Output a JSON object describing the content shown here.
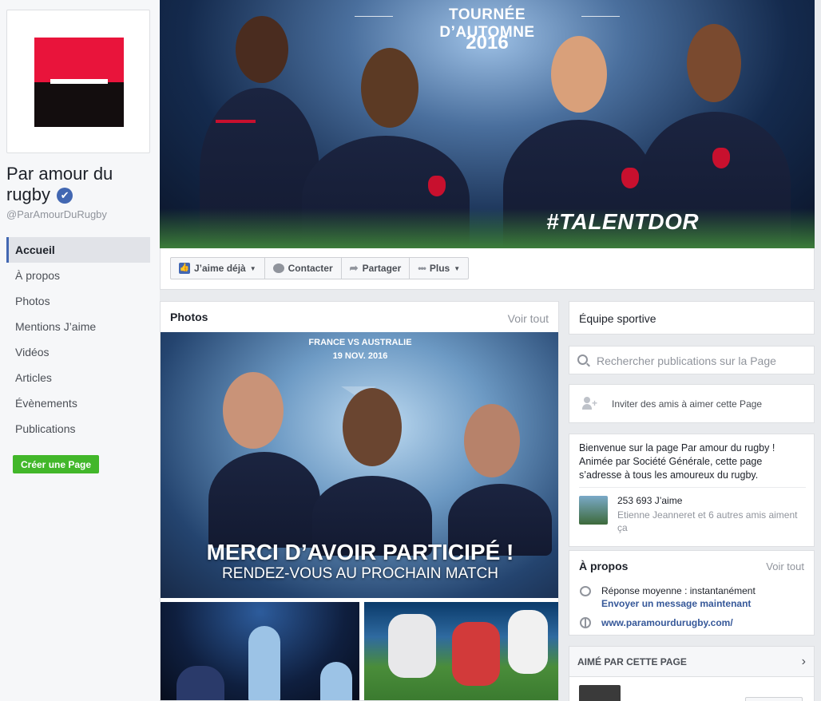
{
  "page": {
    "name": "Par amour du rugby",
    "handle": "@ParAmourDuRugby",
    "verified_icon": "✔",
    "logo_colors": {
      "top": "#e9143b",
      "bottom": "#130d0e"
    }
  },
  "left_nav": {
    "items": [
      {
        "label": "Accueil",
        "active": true
      },
      {
        "label": "À propos"
      },
      {
        "label": "Photos"
      },
      {
        "label": "Mentions J’aime"
      },
      {
        "label": "Vidéos"
      },
      {
        "label": "Articles"
      },
      {
        "label": "Évènements"
      },
      {
        "label": "Publications"
      }
    ],
    "create_page_label": "Créer une Page"
  },
  "cover": {
    "title": "TOURNÉE D’AUTOMNE",
    "year": "2016",
    "hashtag": "#TALENTDOR"
  },
  "actions": {
    "like_label": "J’aime déjà",
    "contact_label": "Contacter",
    "share_label": "Partager",
    "more_label": "Plus"
  },
  "photos": {
    "title": "Photos",
    "see_all": "Voir tout",
    "featured": {
      "match": "FRANCE VS AUSTRALIE",
      "date": "19 NOV. 2016",
      "headline": "MERCI D’AVOIR PARTICIPÉ !",
      "subline": "RENDEZ-VOUS AU PROCHAIN MATCH"
    }
  },
  "sidebar": {
    "category": "Équipe sportive",
    "search_placeholder": "Rechercher publications sur la Page",
    "invite_label": "Inviter des amis à aimer cette Page",
    "welcome": "Bienvenue sur la page Par amour du rugby ! Animée par Société Générale, cette page s’adresse à tous les amoureux du rugby.",
    "likes_count": "253 693 J’aime",
    "likes_friends": "Etienne Jeanneret et 6 autres amis aiment ça",
    "about": {
      "title": "À propos",
      "see_all": "Voir tout",
      "response": "Réponse moyenne : instantanément",
      "send_message": "Envoyer un message maintenant",
      "website": "www.paramourdurugby.com/"
    },
    "liked_by_page": {
      "title": "AIMÉ PAR CETTE PAGE",
      "chevron": "›"
    }
  }
}
